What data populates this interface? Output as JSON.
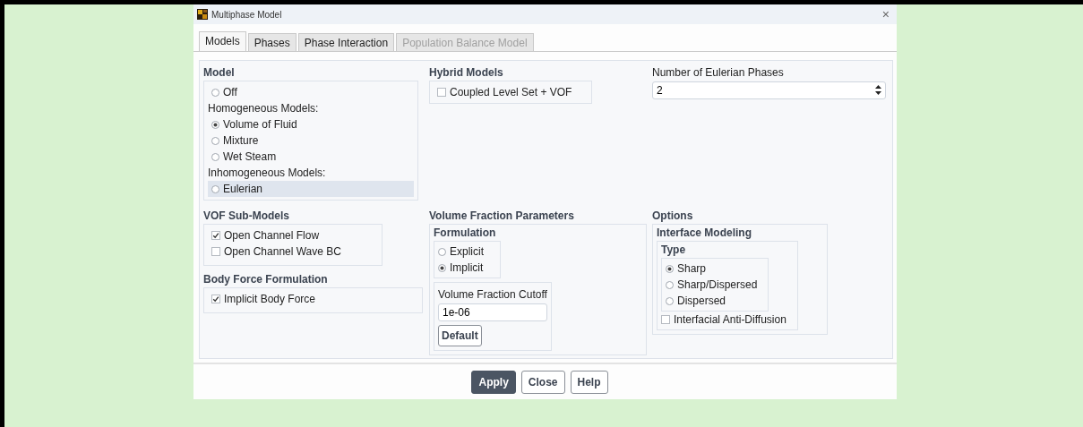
{
  "window": {
    "title": "Multiphase Model",
    "close": "×"
  },
  "tabs": [
    {
      "label": "Models",
      "selected": true,
      "disabled": false
    },
    {
      "label": "Phases",
      "selected": false,
      "disabled": false
    },
    {
      "label": "Phase Interaction",
      "selected": false,
      "disabled": false
    },
    {
      "label": "Population Balance Model",
      "selected": false,
      "disabled": true
    }
  ],
  "model": {
    "title": "Model",
    "items": [
      {
        "kind": "radio",
        "label": "Off",
        "selected": false,
        "highlighted": false
      },
      {
        "kind": "heading",
        "label": "Homogeneous Models:"
      },
      {
        "kind": "radio",
        "label": "Volume of Fluid",
        "selected": true,
        "highlighted": false
      },
      {
        "kind": "radio",
        "label": "Mixture",
        "selected": false,
        "highlighted": false
      },
      {
        "kind": "radio",
        "label": "Wet Steam",
        "selected": false,
        "highlighted": false
      },
      {
        "kind": "heading",
        "label": "Inhomogeneous Models:"
      },
      {
        "kind": "radio",
        "label": "Eulerian",
        "selected": false,
        "highlighted": true
      }
    ]
  },
  "hybrid_models": {
    "title": "Hybrid Models",
    "options": [
      {
        "label": "Coupled Level Set + VOF",
        "checked": false
      }
    ]
  },
  "eulerian_phases": {
    "label": "Number of Eulerian Phases",
    "value": "2"
  },
  "vof_sub_models": {
    "title": "VOF Sub-Models",
    "options": [
      {
        "label": "Open Channel Flow",
        "checked": true
      },
      {
        "label": "Open Channel Wave BC",
        "checked": false
      }
    ]
  },
  "body_force": {
    "title": "Body Force Formulation",
    "options": [
      {
        "label": "Implicit Body Force",
        "checked": true
      }
    ]
  },
  "volume_fraction": {
    "title": "Volume Fraction Parameters",
    "formulation": {
      "title": "Formulation",
      "options": [
        {
          "label": "Explicit",
          "selected": false
        },
        {
          "label": "Implicit",
          "selected": true
        }
      ]
    },
    "cutoff": {
      "label": "Volume Fraction Cutoff",
      "value": "1e-06",
      "button": "Default"
    }
  },
  "options": {
    "title": "Options",
    "interface_modeling": {
      "title": "Interface Modeling",
      "type": {
        "title": "Type",
        "options": [
          {
            "label": "Sharp",
            "selected": true
          },
          {
            "label": "Sharp/Dispersed",
            "selected": false
          },
          {
            "label": "Dispersed",
            "selected": false
          }
        ]
      },
      "anti_diffusion": {
        "label": "Interfacial Anti-Diffusion",
        "checked": false
      }
    }
  },
  "buttons": [
    {
      "label": "Apply",
      "kind": "primary"
    },
    {
      "label": "Close",
      "kind": "normal"
    },
    {
      "label": "Help",
      "kind": "normal"
    }
  ]
}
